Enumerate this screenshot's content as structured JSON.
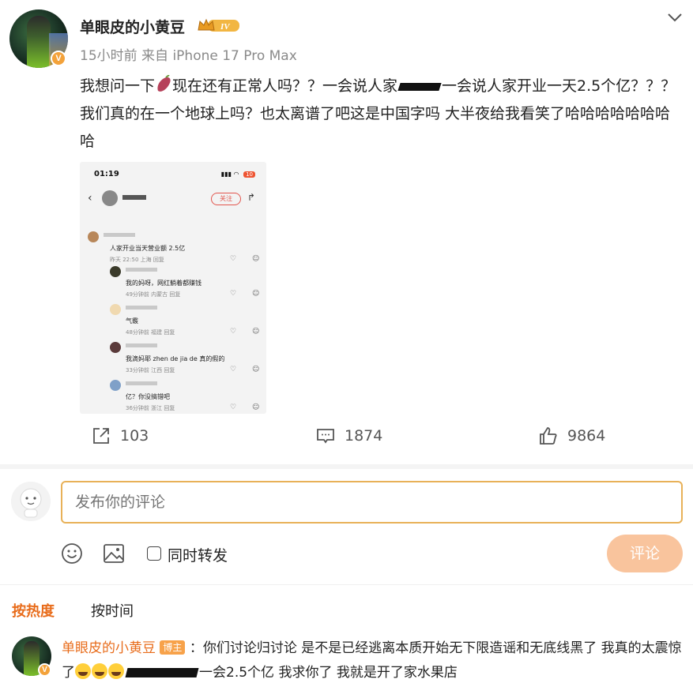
{
  "post": {
    "username": "单眼皮的小黄豆",
    "level_badge": "IV",
    "verified_badge": "V",
    "meta": "15小时前  来自 iPhone 17 Pro Max",
    "text_1": "我想问一下",
    "text_2": "现在还有正常人吗？？一会说人家",
    "text_3": "一会说人家开业一天2.5个亿？？？我们真的在一个地球上吗？也太离谱了吧这是中国字吗 大半夜给我看笑了哈哈哈哈哈哈哈哈"
  },
  "embedded_screenshot": {
    "time": "01:19",
    "battery": "10",
    "follow_label": "关注",
    "comments": [
      {
        "text": "人家开业当天营业额 2.5亿",
        "meta": "昨天 22:50 上海   回复"
      },
      {
        "text": "我的妈呀，网红躺着都赚钱",
        "meta": "49分钟前 内蒙古   回复"
      },
      {
        "text": "气霰",
        "meta": "48分钟前 福建   回复"
      },
      {
        "text": "我滴妈耶 zhen de jia de 真的假的",
        "meta": "33分钟前 江西   回复"
      },
      {
        "text": "亿？你没搞错吧",
        "meta": "36分钟前 浙江   回复"
      }
    ]
  },
  "actions": {
    "repost_count": "103",
    "comment_count": "1874",
    "like_count": "9864"
  },
  "comment_box": {
    "placeholder": "发布你的评论",
    "repost_checkbox_label": "同时转发",
    "submit_label": "评论"
  },
  "sort": {
    "hot": "按热度",
    "time": "按时间"
  },
  "first_comment": {
    "author": "单眼皮的小黄豆",
    "author_tag": "博主",
    "text_1": "：你们讨论归讨论 是不是已经逃离本质开始无下限造谣和无底线黑了 我真的太震惊了",
    "text_2": "一会2.5个亿 我求你了 我就是开了家水果店"
  },
  "colors": {
    "accent": "#e86c1b",
    "input_border": "#e8b158",
    "submit_bg": "#f9c49d"
  }
}
